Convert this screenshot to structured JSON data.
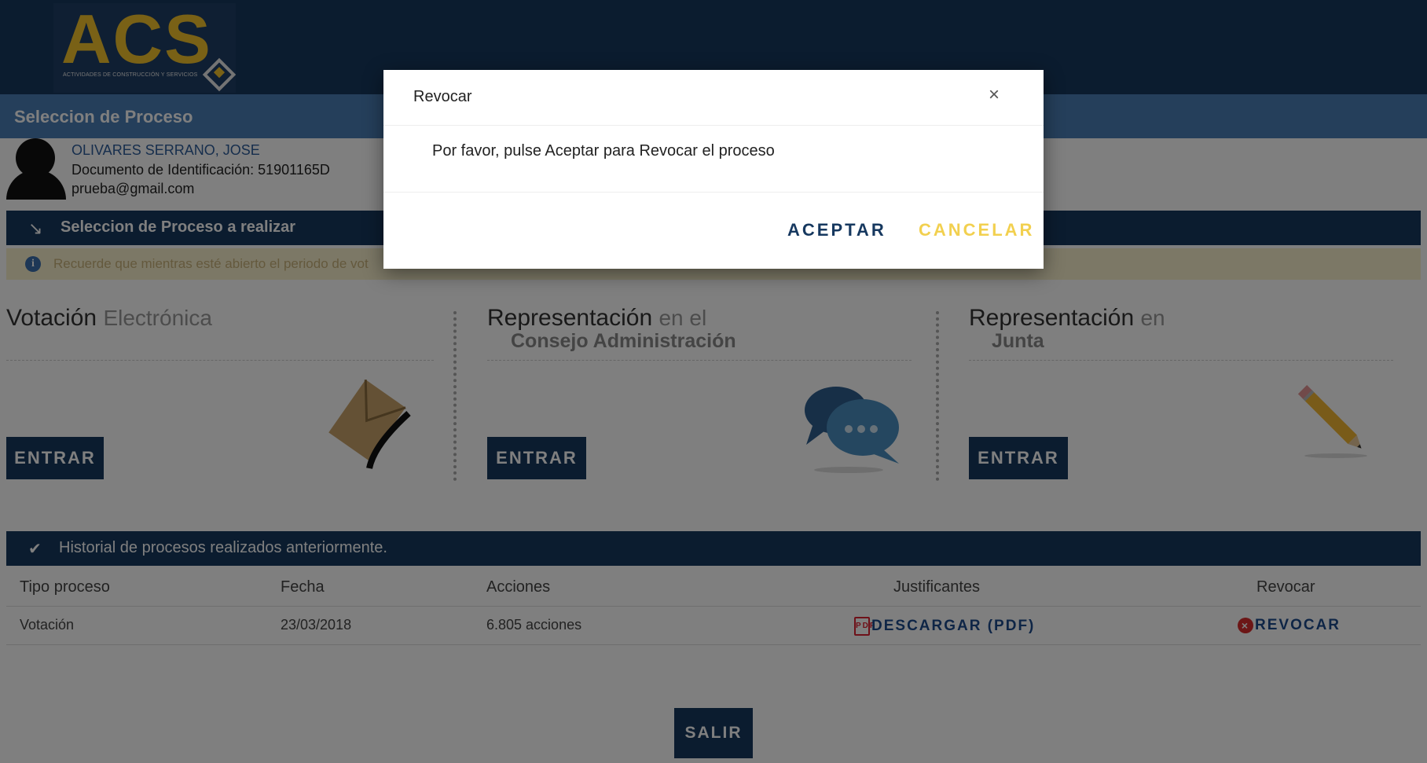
{
  "brand": {
    "logo_text": "ACS",
    "logo_subtext": "ACTIVIDADES DE CONSTRUCCIÓN Y SERVICIOS"
  },
  "page_title": "Seleccion de Proceso",
  "user": {
    "name": "OLIVARES SERRANO, JOSE",
    "document": "Documento de Identificación: 51901165D",
    "email": "prueba@gmail.com"
  },
  "process_section": {
    "title": "Seleccion de Proceso a realizar",
    "notice": "Recuerde que mientras esté abierto el periodo de vot"
  },
  "options": [
    {
      "title": "Votación",
      "title_suffix": "Electrónica",
      "subtitle": "",
      "button": "ENTRAR",
      "icon": "envelope-icon"
    },
    {
      "title": "Representación",
      "title_suffix": "en el",
      "subtitle": "Consejo Administración",
      "button": "ENTRAR",
      "icon": "speech-bubbles-icon"
    },
    {
      "title": "Representación",
      "title_suffix": "en",
      "subtitle": "Junta",
      "button": "ENTRAR",
      "icon": "pencil-icon"
    }
  ],
  "history": {
    "title": "Historial de procesos realizados anteriormente.",
    "columns": [
      "Tipo proceso",
      "Fecha",
      "Acciones",
      "Justificantes",
      "Revocar"
    ],
    "rows": [
      {
        "tipo": "Votación",
        "fecha": "23/03/2018",
        "acciones": "6.805 acciones",
        "justificante": "DESCARGAR (PDF)",
        "revocar": "REVOCAR"
      }
    ]
  },
  "exit_button": "SALIR",
  "modal": {
    "title": "Revocar",
    "close": "×",
    "message": "Por favor, pulse Aceptar para Revocar el proceso",
    "accept": "ACEPTAR",
    "cancel": "CANCELAR"
  },
  "colors": {
    "navy": "#16385f",
    "title_bar": "#4a7fb7",
    "logo_gold": "#f2c22c",
    "cancel_yellow": "#f2d04f"
  }
}
